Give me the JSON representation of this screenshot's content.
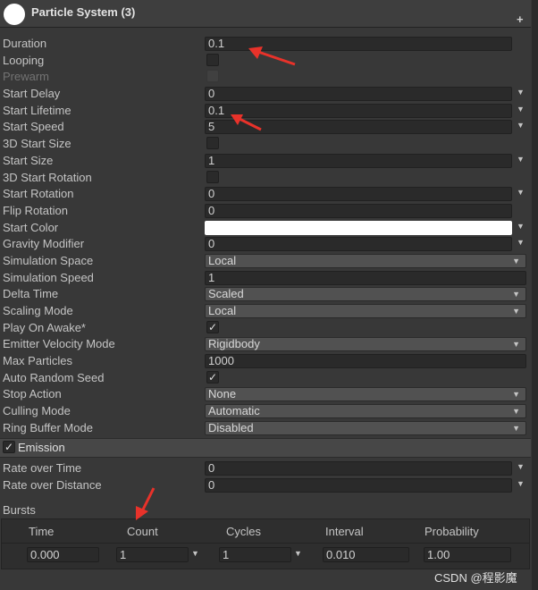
{
  "header": {
    "title": "Particle System (3)",
    "plus": "+"
  },
  "main_rows": [
    {
      "label": "Duration",
      "kind": "num",
      "value": "0.1"
    },
    {
      "label": "Looping",
      "kind": "check",
      "checked": false
    },
    {
      "label": "Prewarm",
      "kind": "check",
      "checked": false,
      "disabled": true
    },
    {
      "label": "Start Delay",
      "kind": "curve",
      "value": "0"
    },
    {
      "label": "Start Lifetime",
      "kind": "curve",
      "value": "0.1"
    },
    {
      "label": "Start Speed",
      "kind": "curve",
      "value": "5"
    },
    {
      "label": "3D Start Size",
      "kind": "check",
      "checked": false
    },
    {
      "label": "Start Size",
      "kind": "curve",
      "value": "1"
    },
    {
      "label": "3D Start Rotation",
      "kind": "check",
      "checked": false
    },
    {
      "label": "Start Rotation",
      "kind": "curve",
      "value": "0"
    },
    {
      "label": "Flip Rotation",
      "kind": "num",
      "value": "0"
    },
    {
      "label": "Start Color",
      "kind": "color",
      "color": "#ffffff"
    },
    {
      "label": "Gravity Modifier",
      "kind": "curve",
      "value": "0"
    },
    {
      "label": "Simulation Space",
      "kind": "select",
      "value": "Local"
    },
    {
      "label": "Simulation Speed",
      "kind": "full",
      "value": "1"
    },
    {
      "label": "Delta Time",
      "kind": "select",
      "value": "Scaled"
    },
    {
      "label": "Scaling Mode",
      "kind": "select",
      "value": "Local"
    },
    {
      "label": "Play On Awake*",
      "kind": "check",
      "checked": true
    },
    {
      "label": "Emitter Velocity Mode",
      "kind": "select",
      "value": "Rigidbody"
    },
    {
      "label": "Max Particles",
      "kind": "full",
      "value": "1000"
    },
    {
      "label": "Auto Random Seed",
      "kind": "check",
      "checked": true
    },
    {
      "label": "Stop Action",
      "kind": "select",
      "value": "None"
    },
    {
      "label": "Culling Mode",
      "kind": "select",
      "value": "Automatic"
    },
    {
      "label": "Ring Buffer Mode",
      "kind": "select",
      "value": "Disabled"
    }
  ],
  "emission": {
    "title": "Emission",
    "checked": true,
    "rows": [
      {
        "label": "Rate over Time",
        "kind": "curve",
        "value": "0"
      },
      {
        "label": "Rate over Distance",
        "kind": "curve",
        "value": "0"
      }
    ],
    "bursts_label": "Bursts",
    "bursts_headers": [
      "Time",
      "Count",
      "Cycles",
      "Interval",
      "Probability"
    ],
    "burst_row": {
      "time": "0.000",
      "count": "1",
      "cycles": "1",
      "interval": "0.010",
      "probability": "1.00"
    }
  },
  "watermark": "CSDN @程影魔",
  "colors": {
    "annotation": "#e8322a",
    "panel": "#383838",
    "field": "#2a2a2a"
  }
}
